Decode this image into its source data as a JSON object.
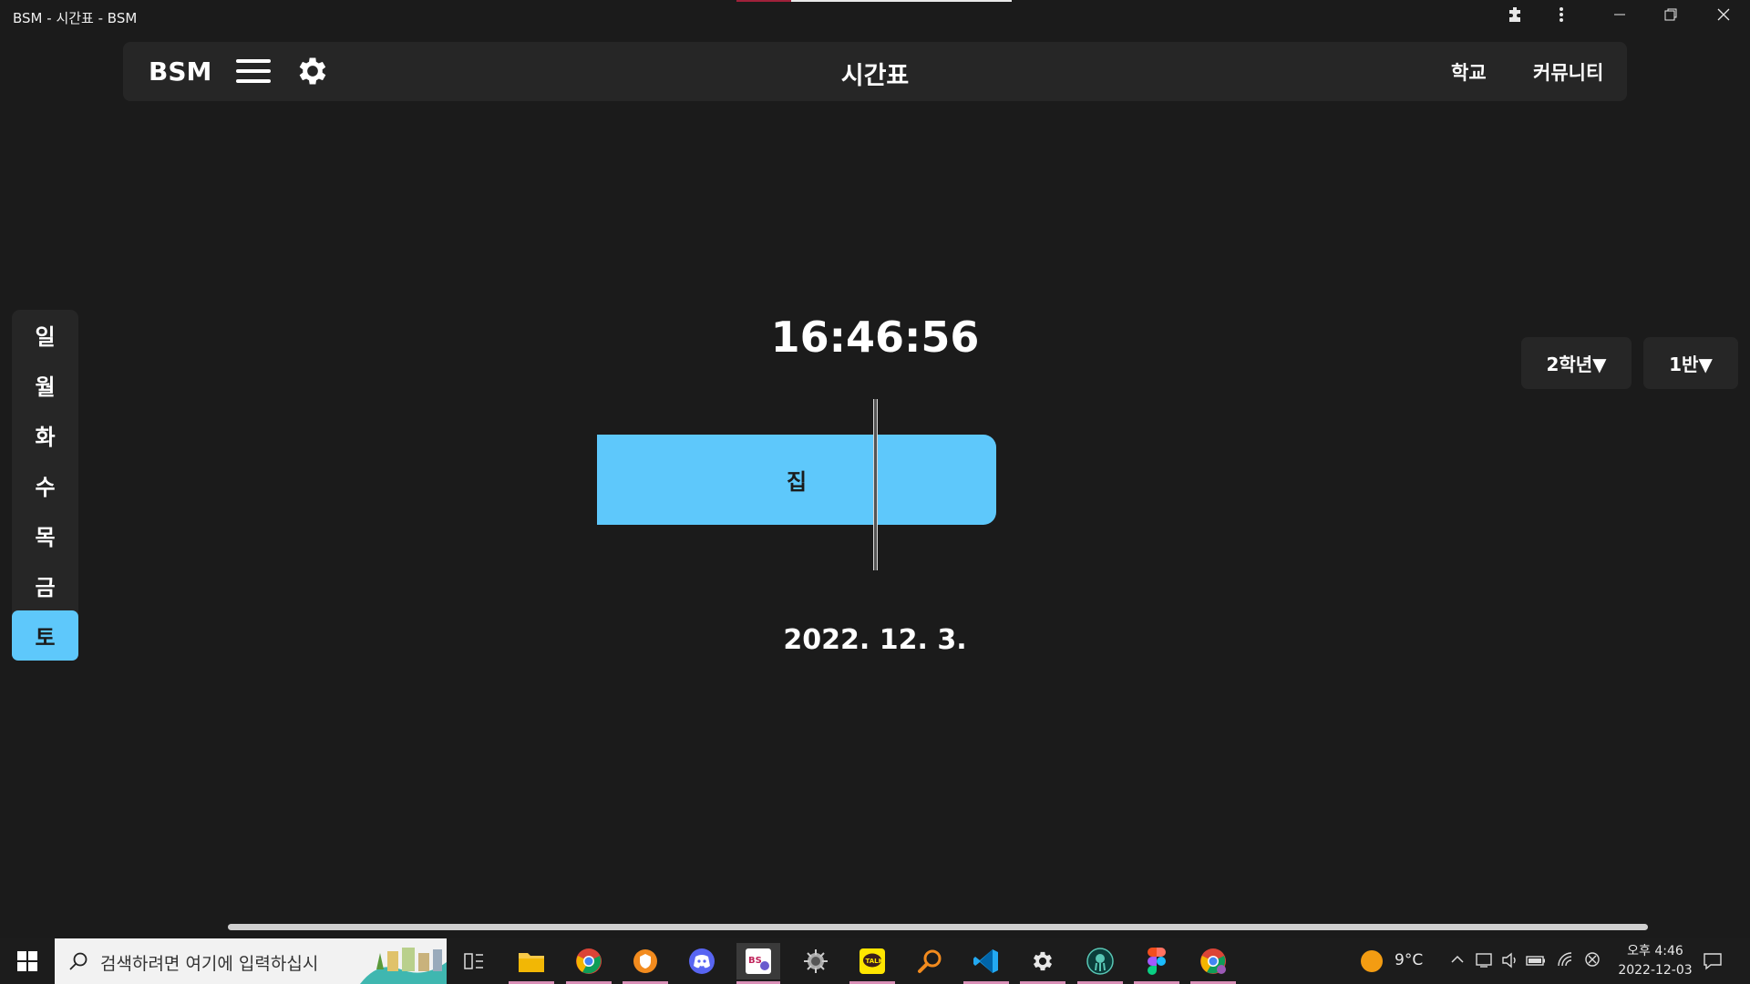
{
  "window": {
    "title": "BSM - 시간표 - BSM",
    "extensions_icon": "puzzle-icon",
    "more_icon": "kebab-icon"
  },
  "header": {
    "logo": "BSM",
    "title": "시간표",
    "nav": [
      "학교",
      "커뮤니티"
    ]
  },
  "days": [
    "일",
    "월",
    "화",
    "수",
    "목",
    "금",
    "토"
  ],
  "selected_day": "토",
  "clock": "16:46:56",
  "current_period": "집",
  "date": "2022. 12. 3.",
  "grade_select": "2학년▼",
  "class_select": "1반▼",
  "taskbar": {
    "search_placeholder": "검색하려면 여기에 입력하십시",
    "weather": "9°C",
    "tray_time": "오후 4:46",
    "tray_date": "2022-12-03"
  },
  "colors": {
    "background": "#1b1b1b",
    "panel": "#262626",
    "accent": "#5ec8fb"
  }
}
